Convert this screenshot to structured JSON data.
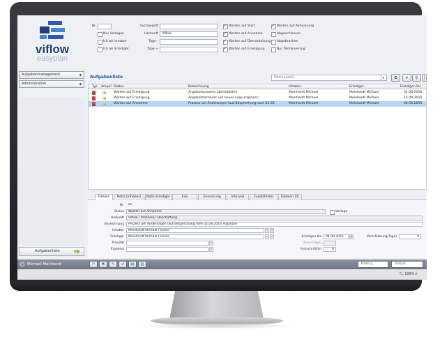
{
  "logo": {
    "word": "viflow",
    "sub": "easyplan"
  },
  "sidebar": {
    "dropdowns": [
      {
        "label": "Aufgabenmanagement"
      },
      {
        "label": "Administration"
      }
    ],
    "task_button": "Aufgabenliste"
  },
  "filters": {
    "nr_label": "Nr.",
    "suchbegriff_label": "Suchbegriff",
    "herkunft_label": "Herkunft",
    "herkunft_value": "Viflow",
    "tage_minus_label": "Tage -",
    "tage_plus_label": "Tage +",
    "left_checks": [
      {
        "label": "Nur Vorlagen",
        "checked": false
      },
      {
        "label": "Ich als Inhaber",
        "checked": false
      },
      {
        "label": "Ich als Erlediger",
        "checked": false
      }
    ],
    "mid_checks": [
      {
        "label": "Warten auf Start",
        "checked": true
      },
      {
        "label": "Warten auf Annahme",
        "checked": true
      },
      {
        "label": "Warten auf Überarbeitung",
        "checked": true
      },
      {
        "label": "Warten auf Erledigung",
        "checked": true
      }
    ],
    "right_checks": [
      {
        "label": "Warten auf Aktivierung",
        "checked": true
      },
      {
        "label": "Abgeschlossen",
        "checked": false
      },
      {
        "label": "Abgebrochen",
        "checked": false
      },
      {
        "label": "Nur Terminverzug",
        "checked": false
      }
    ]
  },
  "list": {
    "title": "Aufgabenliste",
    "filter_placeholder": "Filterauswahl",
    "columns": [
      "Typ",
      "Ampel",
      "Status",
      "Bezeichnung",
      "Inhaber",
      "Erlediger",
      "Erledigen bis"
    ],
    "rows": [
      {
        "status": "Warten auf Erledigung",
        "bezeichnung": "Angebotsprozess überarbeiten",
        "inhaber": "Meinhardt Michael",
        "erlediger": "Meinhardt Michael",
        "bis": "31.08.2016",
        "selected": false
      },
      {
        "status": "Warten auf Erledigung",
        "bezeichnung": "Angebotsformular um neues Logo ergänzen",
        "inhaber": "Meinhardt Michael",
        "erlediger": "Meinhardt Michael",
        "bis": "15.09.2016",
        "selected": false
      },
      {
        "status": "Warten auf Annahme",
        "bezeichnung": "Prozess um Änderungen laut Besprechung vom 02.08",
        "inhaber": "Meinhardt Michael",
        "erlediger": "Meinhardt Michael",
        "bis": "04.08.2016",
        "selected": true
      }
    ]
  },
  "detail": {
    "tabs": [
      "Details",
      "Notiz (Inhaber)",
      "Notiz Erlediger",
      "Info",
      "Erinnerung",
      "Intervall",
      "Zusatzfelder",
      "Dateien (0)"
    ],
    "nr_label": "Nr.",
    "nr_value": "30",
    "status_label": "Status",
    "status_value": "Warten auf Annahme",
    "vorlage_label": "Vorlage",
    "herkunft_label": "Herkunft",
    "herkunft_value": "Viflow / Prozesse / Beschaffung",
    "bezeichnung_label": "Bezeichnung",
    "bezeichnung_value": "Prozess um Änderungen laut Besprechung vom 02.08.2016 ergänzen",
    "inhaber_label": "Inhaber",
    "inhaber_value": "Meinhardt Michael (Vicon)",
    "erlediger_label": "Erlediger",
    "erlediger_value": "Meinhardt Michael (Vicon)",
    "prioritaet_label": "Priorität",
    "ergebnis_label": "Ergebnis",
    "erledigen_bis_label": "Erledigen bis",
    "erledigen_bis_value": "04.08.2016",
    "verschiebung_label": "Verschiebung(Tage)",
    "verschiebung_value": "0",
    "dauer_label": "Dauer(Tage)",
    "fortschritt_label": "Fortschritt(%)",
    "fortschritt_value": "0"
  },
  "statusbar": {
    "user": "Michael Meinhardt",
    "history": "History",
    "zurueck": "Zurück",
    "zoom": "100%"
  }
}
